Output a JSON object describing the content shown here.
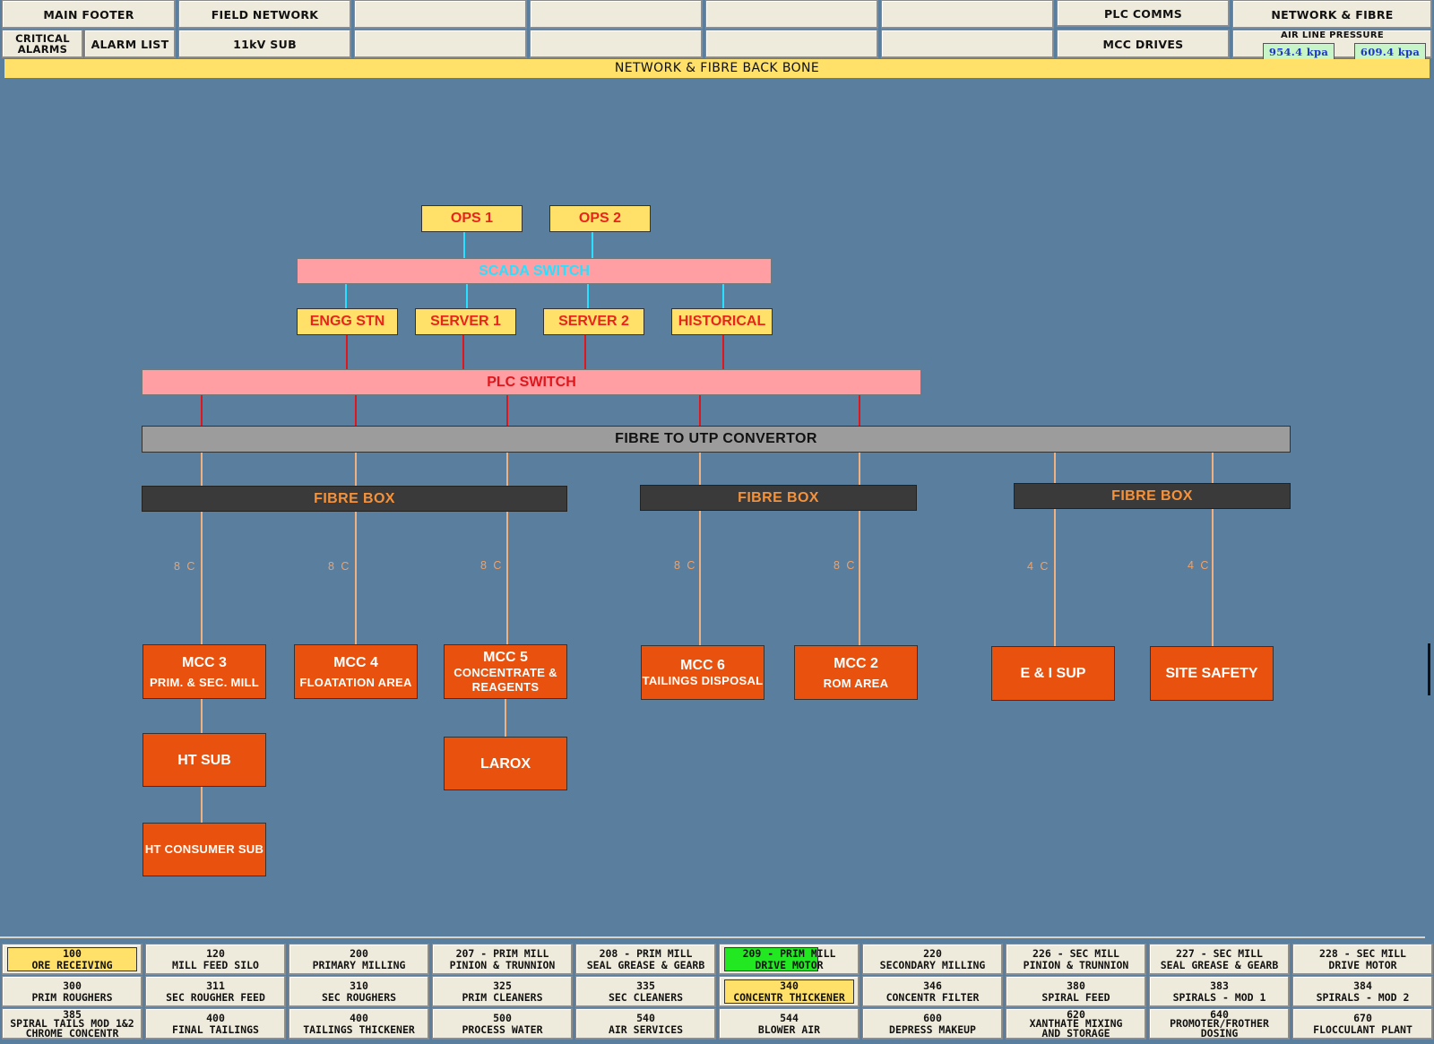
{
  "top_nav": {
    "main_footer": "MAIN FOOTER",
    "field_network": "FIELD NETWORK",
    "plc_comms": "PLC COMMS",
    "network_fibre": "NETWORK & FIBRE",
    "critical_alarms_1": "CRITICAL",
    "critical_alarms_2": "ALARMS",
    "alarm_list": "ALARM LIST",
    "sub_11kv": "11kV SUB",
    "mcc_drives": "MCC DRIVES",
    "air_line_pressure": "AIR LINE PRESSURE",
    "pressure_1": "954.4 kpa",
    "pressure_2": "609.4 kpa"
  },
  "page_title": "NETWORK & FIBRE BACK BONE",
  "diagram": {
    "ops1": "OPS 1",
    "ops2": "OPS 2",
    "scada_switch": "SCADA SWITCH",
    "engg_stn": "ENGG STN",
    "server1": "SERVER 1",
    "server2": "SERVER 2",
    "historical": "HISTORICAL",
    "plc_switch": "PLC SWITCH",
    "fibre_convertor": "FIBRE TO UTP CONVERTOR",
    "fibre_box": "FIBRE BOX",
    "cable_8c": "8 C",
    "cable_4c": "4 C",
    "mcc3": "MCC 3",
    "mcc3_sub": "PRIM. & SEC. MILL",
    "mcc4": "MCC 4",
    "mcc4_sub": "FLOATATION AREA",
    "mcc5": "MCC 5",
    "mcc5_sub1": "CONCENTRATE &",
    "mcc5_sub2": "REAGENTS",
    "mcc6": "MCC 6",
    "mcc6_sub": "TAILINGS DISPOSAL",
    "mcc2": "MCC 2",
    "mcc2_sub": "ROM AREA",
    "ei_sup": "E & I SUP",
    "site_safety": "SITE SAFETY",
    "ht_sub": "HT SUB",
    "larox": "LAROX",
    "ht_consumer_sub": "HT CONSUMER SUB"
  },
  "colors": {
    "background": "#5a7e9e",
    "yellow": "#ffe16a",
    "pink": "#ff9fa3",
    "orange": "#e8520e",
    "red_line": "#e0161c",
    "cyan_line": "#28e0ff",
    "fibre_line": "#f0b080",
    "running_green": "#22e822"
  },
  "bottom_nav": {
    "row1": [
      {
        "l1": "100",
        "l2": "ORE RECEIVING",
        "hl": "yellow"
      },
      {
        "l1": "120",
        "l2": "MILL FEED SILO"
      },
      {
        "l1": "200",
        "l2": "PRIMARY MILLING"
      },
      {
        "l1": "207 - PRIM MILL",
        "l2": "PINION & TRUNNION"
      },
      {
        "l1": "208 - PRIM MILL",
        "l2": "SEAL GREASE & GEARB"
      },
      {
        "l1": "209 - PRIM MILL",
        "l2": "DRIVE MOTOR",
        "hl": "green"
      },
      {
        "l1": "220",
        "l2": "SECONDARY MILLING"
      },
      {
        "l1": "226 - SEC MILL",
        "l2": "PINION & TRUNNION"
      },
      {
        "l1": "227 - SEC MILL",
        "l2": "SEAL GREASE & GEARB"
      },
      {
        "l1": "228 - SEC MILL",
        "l2": "DRIVE MOTOR"
      }
    ],
    "row2": [
      {
        "l1": "300",
        "l2": "PRIM ROUGHERS"
      },
      {
        "l1": "311",
        "l2": "SEC ROUGHER FEED"
      },
      {
        "l1": "310",
        "l2": "SEC ROUGHERS"
      },
      {
        "l1": "325",
        "l2": "PRIM CLEANERS"
      },
      {
        "l1": "335",
        "l2": "SEC CLEANERS"
      },
      {
        "l1": "340",
        "l2": "CONCENTR THICKENER",
        "hl": "yellow"
      },
      {
        "l1": "346",
        "l2": "CONCENTR FILTER"
      },
      {
        "l1": "380",
        "l2": "SPIRAL FEED"
      },
      {
        "l1": "383",
        "l2": "SPIRALS - MOD 1"
      },
      {
        "l1": "384",
        "l2": "SPIRALS - MOD 2"
      }
    ],
    "row3": [
      {
        "l1": "385",
        "l2": "SPIRAL TAILS MOD 1&2",
        "l3": "CHROME CONCENTR"
      },
      {
        "l1": "400",
        "l2": "FINAL TAILINGS"
      },
      {
        "l1": "400",
        "l2": "TAILINGS THICKENER"
      },
      {
        "l1": "500",
        "l2": "PROCESS WATER"
      },
      {
        "l1": "540",
        "l2": "AIR SERVICES"
      },
      {
        "l1": "544",
        "l2": "BLOWER AIR"
      },
      {
        "l1": "600",
        "l2": "DEPRESS MAKEUP"
      },
      {
        "l1": "620",
        "l2": "XANTHATE MIXING",
        "l3": "AND STORAGE"
      },
      {
        "l1": "640",
        "l2": "PROMOTER/FROTHER",
        "l3": "DOSING"
      },
      {
        "l1": "670",
        "l2": "FLOCCULANT PLANT"
      }
    ]
  }
}
